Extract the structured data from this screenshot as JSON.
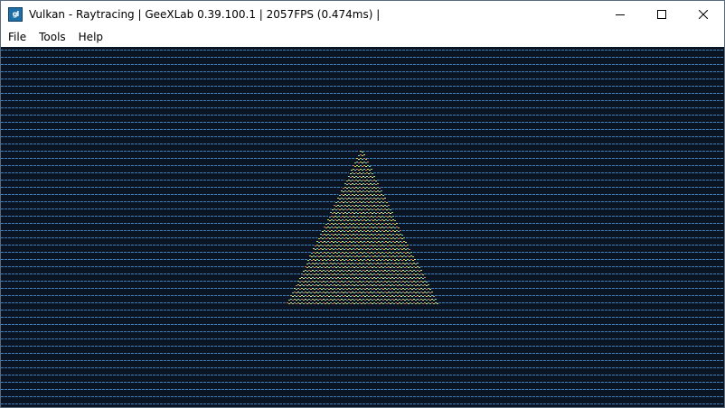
{
  "window": {
    "title": "Vulkan - Raytracing | GeeXLab 0.39.100.1 | 2057FPS (0.474ms) |",
    "icon": "geexlab-app-icon",
    "controls": {
      "minimize_icon": "minimize-icon",
      "maximize_icon": "maximize-icon",
      "close_icon": "close-icon"
    }
  },
  "menu": {
    "items": [
      {
        "label": "File"
      },
      {
        "label": "Tools"
      },
      {
        "label": "Help"
      }
    ]
  },
  "viewport": {
    "background_color": "#0a1422",
    "scanline_color": "#3a84c4",
    "triangle_colors": [
      "#d9d24a",
      "#e07a6a",
      "#7ed6d0",
      "#a9e070",
      "#e8e8a0"
    ]
  }
}
